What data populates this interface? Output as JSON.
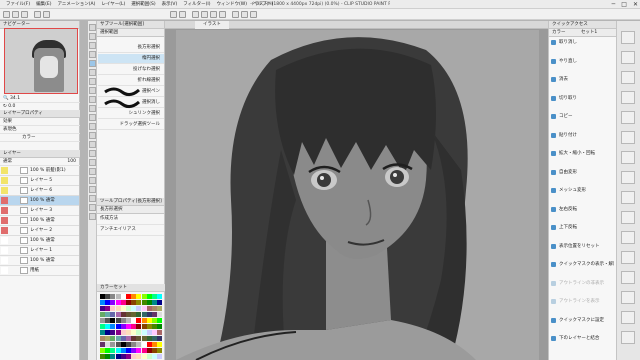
{
  "window": {
    "title": "イラスト* (1800 x 4400px 72dpi) (0.0%) - CLIP STUDIO PAINT PRO",
    "menu": [
      "ファイル(F)",
      "編集(E)",
      "アニメーション(A)",
      "レイヤー(L)",
      "選択範囲(S)",
      "表示(V)",
      "フィルター(I)",
      "ウィンドウ(W)",
      "ヘルプ(H)"
    ],
    "controls": {
      "minimize": "─",
      "maximize": "□",
      "close": "✕"
    }
  },
  "left_panel": {
    "navigator_tab": "ナビゲーター",
    "zoom_value": "34.1",
    "rotate_value": "0.0",
    "layer_property_tab": "レイヤープロパティ",
    "effect_label": "効果",
    "blend_label": "表現色",
    "blend_value": "カラー",
    "layer_tab": "レイヤー",
    "blend_mode": "通常",
    "opacity": "100",
    "layers": [
      {
        "name": "100 % 前髪(影1)",
        "color": "#f2e46a",
        "selected": false
      },
      {
        "name": "レイヤー 5",
        "color": "#f2e46a",
        "selected": false
      },
      {
        "name": "レイヤー 6",
        "color": "#f2e46a",
        "selected": false
      },
      {
        "name": "100 % 通常",
        "color": "#e06c6c",
        "selected": true
      },
      {
        "name": "レイヤー 3",
        "color": "#e06c6c",
        "selected": false
      },
      {
        "name": "100 % 通常",
        "color": "#e06c6c",
        "selected": false
      },
      {
        "name": "レイヤー 2",
        "color": "#e06c6c",
        "selected": false
      },
      {
        "name": "100 % 通常",
        "color": "#ffffff",
        "selected": false
      },
      {
        "name": "レイヤー 1",
        "color": "#ffffff",
        "selected": false
      },
      {
        "name": "100 % 通常",
        "color": "#ffffff",
        "selected": false
      },
      {
        "name": "用紙",
        "color": "#ffffff",
        "selected": false
      }
    ]
  },
  "sub_tool": {
    "tab": "サブツール[選択範囲]",
    "header": "選択範囲",
    "items": [
      {
        "label": "長方形選択",
        "selected": false
      },
      {
        "label": "楕円選択",
        "selected": true
      },
      {
        "label": "投げなわ選択",
        "selected": false
      },
      {
        "label": "折れ線選択",
        "selected": false
      },
      {
        "label": "選択ペン",
        "selected": false
      },
      {
        "label": "選択消し",
        "selected": false
      },
      {
        "label": "シュリンク選択",
        "selected": false
      },
      {
        "label": "ドラッグ選択ツール",
        "selected": false
      }
    ]
  },
  "tool_property": {
    "tab": "ツールプロパティ[長方形選択]",
    "header": "長方形選択",
    "mode_label": "作成方法",
    "antialias_label": "アンチエイリアス",
    "color_set_tab": "カラーセット"
  },
  "canvas": {
    "tab": "イラスト"
  },
  "right_panel": {
    "tab_quick_access": "クイックアクセス",
    "tab_label": "カラー",
    "tab_label2": "セット1",
    "items": [
      {
        "label": "取り消し",
        "disabled": false
      },
      {
        "label": "やり直し",
        "disabled": false
      },
      {
        "label": "消去",
        "disabled": false
      },
      {
        "label": "切り取り",
        "disabled": false
      },
      {
        "label": "コピー",
        "disabled": false
      },
      {
        "label": "貼り付け",
        "disabled": false
      },
      {
        "label": "拡大・縮小・回転",
        "disabled": false
      },
      {
        "label": "自由変形",
        "disabled": false
      },
      {
        "label": "メッシュ変形",
        "disabled": false
      },
      {
        "label": "左右反転",
        "disabled": false
      },
      {
        "label": "上下反転",
        "disabled": false
      },
      {
        "label": "表示位置をリセット",
        "disabled": false
      },
      {
        "label": "クイックマスクの表示・解除",
        "disabled": false
      },
      {
        "label": "アウトラインの非表示",
        "disabled": true
      },
      {
        "label": "アウトラインを表示",
        "disabled": true
      },
      {
        "label": "クイックマスクに設定",
        "disabled": false
      },
      {
        "label": "下のレイヤーと結合",
        "disabled": false
      }
    ]
  },
  "colors": {
    "accent": "#4a90c8",
    "selection": "#cde4f4",
    "layer_selected": "#b9d6ee"
  }
}
